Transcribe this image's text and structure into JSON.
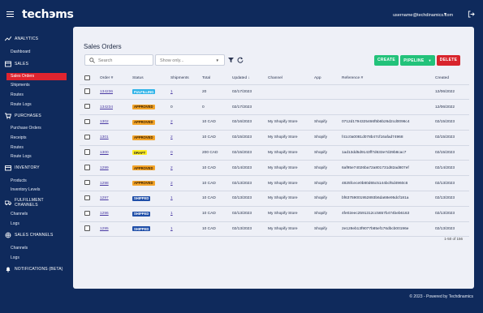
{
  "topbar": {
    "logo": "techэms",
    "user_email": "username@techdinamics.com",
    "caret": "▼"
  },
  "sidebar": {
    "sections": [
      {
        "label": "ANALYTICS",
        "items": [
          "Dashboard"
        ]
      },
      {
        "label": "SALES",
        "items": [
          "Sales Orders",
          "Shipments",
          "Routes",
          "Route Logs"
        ]
      },
      {
        "label": "PURCHASES",
        "items": [
          "Purchase Orders",
          "Receipts",
          "Routes",
          "Route Logs"
        ]
      },
      {
        "label": "INVENTORY",
        "items": [
          "Products",
          "Inventory Levels"
        ]
      },
      {
        "label": "FULFILLMENT CHANNELS",
        "items": [
          "Channels",
          "Logs"
        ]
      },
      {
        "label": "SALES CHANNELS",
        "items": [
          "Channels",
          "Logs"
        ]
      },
      {
        "label": "NOTIFICATIONS (BETA)",
        "items": []
      }
    ],
    "active_item": "Sales Orders"
  },
  "main": {
    "title": "Sales Orders",
    "search_placeholder": "Search",
    "select_placeholder": "Show only...",
    "select_caret": "▼",
    "buttons": {
      "create": "CREATE",
      "pipeline": "PIPELINE",
      "pipeline_caret": "▼",
      "delete": "DELETE"
    },
    "columns": [
      "Order #",
      "Status",
      "Shipments",
      "Total",
      "Updated ↓",
      "Channel",
      "App",
      "Reference #",
      "Created"
    ],
    "rows": [
      {
        "order": "134236",
        "status": "FULFILLING",
        "shipments": "1",
        "total": "20",
        "updated": "02/17/2023",
        "channel": "",
        "app": "",
        "reference": "",
        "created": "12/06/2022"
      },
      {
        "order": "134234",
        "status": "APPROVED",
        "shipments": "0",
        "total": "0",
        "updated": "02/17/2023",
        "channel": "",
        "app": "",
        "reference": "",
        "created": "12/06/2022"
      },
      {
        "order": "1302",
        "status": "APPROVED",
        "shipments": "2",
        "total": "10 CAD",
        "updated": "02/16/2023",
        "channel": "My Shopify Store",
        "app": "Shopify",
        "reference": "0712d1794325466f5b6b26d2cd0096c4",
        "created": "02/15/2023"
      },
      {
        "order": "1301",
        "status": "APPROVED",
        "shipments": "2",
        "total": "10 CAD",
        "updated": "02/15/2023",
        "channel": "My Shopify Store",
        "app": "Shopify",
        "reference": "f41c0a0081d078b47cf16afad74968",
        "created": "02/15/2023"
      },
      {
        "order": "1300",
        "status": "DRAFT",
        "shipments": "0",
        "total": "200 CAD",
        "updated": "02/15/2023",
        "channel": "My Shopify Store",
        "app": "Shopify",
        "reference": "1ad13dd5d9143ff7d633e7d29b8cac7",
        "created": "02/15/2023"
      },
      {
        "order": "1299",
        "status": "APPROVED",
        "shipments": "2",
        "total": "10 CAD",
        "updated": "02/14/2023",
        "channel": "My Shopify Store",
        "app": "Shopify",
        "reference": "6af95e74026ba72a801731d82ad807ef",
        "created": "02/14/2023"
      },
      {
        "order": "1298",
        "status": "APPROVED",
        "shipments": "2",
        "total": "10 CAD",
        "updated": "02/13/2023",
        "channel": "My Shopify Store",
        "app": "Shopify",
        "reference": "4825fcece0b80d65c5144bcf6d4960c6",
        "created": "02/13/2023"
      },
      {
        "order": "1297",
        "status": "SHIPPED",
        "shipments": "1",
        "total": "10 CAD",
        "updated": "02/13/2023",
        "channel": "My Shopify Store",
        "app": "Shopify",
        "reference": "bf63759001952893b6da68e95dcf181a",
        "created": "02/13/2023"
      },
      {
        "order": "1296",
        "status": "SHIPPED",
        "shipments": "1",
        "total": "10 CAD",
        "updated": "02/13/2023",
        "channel": "My Shopify Store",
        "app": "Shopify",
        "reference": "4fe02eec2591312cc5657b474beb6163",
        "created": "02/13/2023"
      },
      {
        "order": "1295",
        "status": "SHIPPED",
        "shipments": "1",
        "total": "10 CAD",
        "updated": "02/13/2023",
        "channel": "My Shopify Store",
        "app": "Shopify",
        "reference": "2e128eb13f9077b85ef176dbcb00196e",
        "created": "02/13/2023"
      }
    ],
    "pagination": "1-50 of 156"
  },
  "footer": "© 2023 - Powered by Techdinamics",
  "colors": {
    "nav_bg": "#0f2a5c",
    "active": "#e0242f",
    "create": "#22c27a",
    "delete": "#d8242c",
    "link": "#4a3aa3"
  }
}
